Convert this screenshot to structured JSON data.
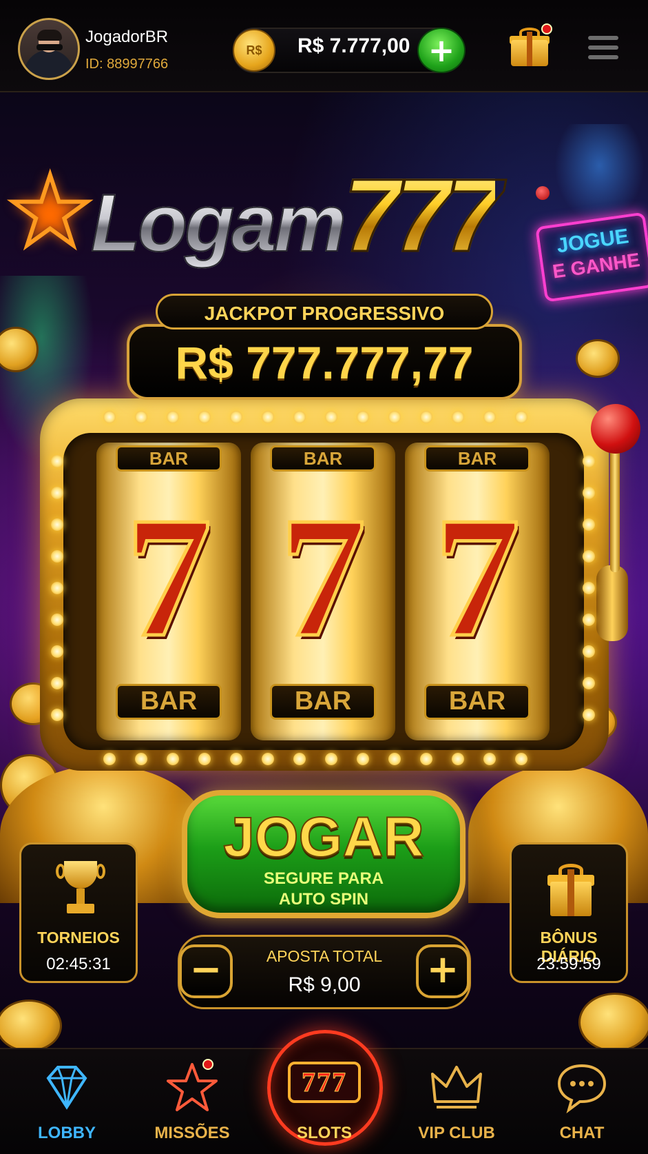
{
  "player": {
    "name": "JogadorBR",
    "id": "ID: 88997766"
  },
  "wallet": {
    "currency_badge": "R$",
    "balance": "R$ 7.777,00",
    "add_label": "+"
  },
  "game": {
    "logo_word": "Logam",
    "logo_number": "777",
    "jackpot_label": "JACKPOT PROGRESSIVO",
    "jackpot_value": "R$ 777.777,77",
    "reels": [
      {
        "top": "BAR",
        "center": "7",
        "bottom": "BAR"
      },
      {
        "top": "BAR",
        "center": "7",
        "bottom": "BAR"
      },
      {
        "top": "BAR",
        "center": "7",
        "bottom": "BAR"
      }
    ],
    "play_label": "JOGAR",
    "play_sub_1": "SEGURE PARA",
    "play_sub_2": "AUTO SPIN"
  },
  "neon_sign": {
    "line1": "JOGUE",
    "line2": "E GANHE"
  },
  "tournaments": {
    "label": "TORNEIOS",
    "timer": "02:45:31",
    "icon": "trophy-icon"
  },
  "daily_bonus": {
    "label": "BÔNUS DIÁRIO",
    "timer": "23:59:59",
    "icon": "gift-icon"
  },
  "bet": {
    "label": "APOSTA TOTAL",
    "value": "R$ 9,00",
    "minus": "−",
    "plus": "+"
  },
  "nav": [
    {
      "label": "LOBBY",
      "icon": "diamond-icon",
      "color": "#3fb6ff"
    },
    {
      "label": "MISSÕES",
      "icon": "star-icon",
      "color": "#e8b24a"
    },
    {
      "label": "SLOTS",
      "icon": "slots-777-icon",
      "color": "#ffd45a",
      "active": true
    },
    {
      "label": "VIP CLUB",
      "icon": "crown-icon",
      "color": "#e8b24a"
    },
    {
      "label": "CHAT",
      "icon": "chat-bubble-icon",
      "color": "#e8b24a"
    }
  ],
  "colors": {
    "gold": "#ffd45a",
    "green": "#1c9e18",
    "red": "#d01010",
    "accent_blue": "#3fb6ff"
  }
}
